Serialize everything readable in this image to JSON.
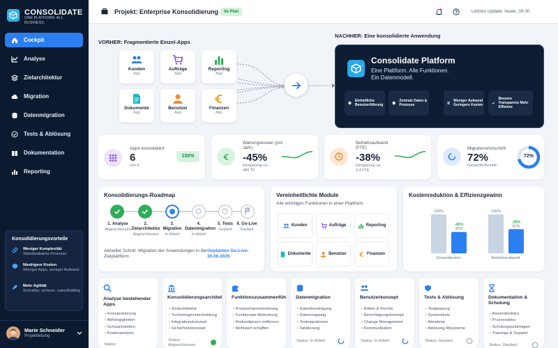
{
  "brand": {
    "name": "CONSOLIDATE",
    "tagline": "ONE PLATFORM. ALL BUSINESS."
  },
  "nav": [
    {
      "label": "Cockpit"
    },
    {
      "label": "Analyse"
    },
    {
      "label": "Zielarchitektur"
    },
    {
      "label": "Migration"
    },
    {
      "label": "Datenmigration"
    },
    {
      "label": "Tests & Ablösung"
    },
    {
      "label": "Dokumentation"
    },
    {
      "label": "Reporting"
    }
  ],
  "benefits": {
    "title": "Konsolidierungsvorteile",
    "items": [
      {
        "title": "Weniger Komplexität",
        "sub": "Standardisierte Prozesse"
      },
      {
        "title": "Niedrigere Kosten",
        "sub": "Weniger Apps, weniger Aufwand"
      },
      {
        "title": "Mehr Agilität",
        "sub": "Schneller, sicherer, zukunftsfähig"
      }
    ]
  },
  "user": {
    "name": "Marie Schneider",
    "role": "Projektleitung"
  },
  "topbar": {
    "project": "Projekt: Enterprise Konsolidierung",
    "badge": "Im Plan",
    "updated": "Letztes Update: heute, 09:30"
  },
  "before": {
    "title": "VORHER: Fragmentierte Einzel-Apps",
    "sub": "App",
    "apps": [
      {
        "name": "Kunden"
      },
      {
        "name": "Aufträge"
      },
      {
        "name": "Reporting"
      },
      {
        "name": "Dokumente"
      },
      {
        "name": "Benutzer"
      },
      {
        "name": "Finanzen"
      }
    ]
  },
  "after": {
    "title": "NACHHER: Eine konsolidierte Anwendung",
    "platform": "Consolidate Platform",
    "line1": "Eine Plattform. Alle Funktionen.",
    "line2": "Ein Datenmodell.",
    "features": [
      "Einheitliche Benutzerführung",
      "Zentrale Daten & Prozesse",
      "Weniger Aufwand Geringere Kosten",
      "Bessere Transparenz Mehr Effizienz"
    ]
  },
  "kpis": {
    "apps": {
      "label": "Apps konsolidiert",
      "value": "6",
      "sub": "von 6",
      "pct": "100%"
    },
    "maint": {
      "label": "Wartungskosten (pro Jahr)",
      "value": "-45%",
      "sub": "Einsparung ca. 480 T€"
    },
    "effort": {
      "label": "Betriebsaufwand (FTE)",
      "value": "-38%",
      "sub": "Einsparung ca. 2,4 FTE"
    },
    "migration": {
      "label": "Migrationsfortschritt",
      "value": "72%",
      "sub": "Gesamtfortschritt",
      "ring": "72%",
      "fraction": 0.72
    }
  },
  "roadmap": {
    "title": "Konsolidierungs-Roadmap",
    "steps": [
      {
        "label": "1. Analyse",
        "status": "Abgeschlossen"
      },
      {
        "label": "2. Zielarchitektur",
        "status": "Abgeschlossen"
      },
      {
        "label": "3. Migration",
        "status": "In Arbeit"
      },
      {
        "label": "4. Datenmigration",
        "status": "In Arbeit"
      },
      {
        "label": "5. Tests",
        "status": "Geplant"
      },
      {
        "label": "6. Go-Live",
        "status": "Geplant"
      }
    ],
    "current": "Aktueller Schritt: Migration der Anwendungen in die Zielplattform",
    "golive": "Geplantes Go-Live: 30.06.2025"
  },
  "modules": {
    "title": "Vereinheitlichte Module",
    "sub": "Alle wichtigen Funktionen in einer Plattform",
    "items": [
      "Kunden",
      "Aufträge",
      "Reporting",
      "Dokumente",
      "Benutzer",
      "Finanzen"
    ]
  },
  "costs": {
    "title": "Kostenreduktion & Effizienzgewinn"
  },
  "chart_data": {
    "type": "bar",
    "categories": [
      "Gesamtkosten",
      "Betriebsaufwand"
    ],
    "series": [
      {
        "values": [
          100,
          100
        ]
      },
      {
        "values": [
          55,
          62
        ]
      }
    ],
    "labels": [
      [
        "100%",
        "-45%",
        "55%"
      ],
      [
        "100%",
        "-38%",
        "62%"
      ]
    ],
    "ylim": [
      0,
      100
    ],
    "colors": [
      "#c9d4e3",
      "#2c7ff0"
    ]
  },
  "phases": [
    {
      "title": "Analyse bestehender Apps",
      "items": [
        "Inventarisierung",
        "Abhängigkeiten",
        "Schwachstellen",
        "Kostenanalyse"
      ],
      "status": "Status:"
    },
    {
      "title": "Konsolidierungsarchitektur",
      "items": [
        "Zielarchitektur",
        "Technologieentscheidung",
        "Integrationskonzept",
        "Sicherheitskonzept"
      ],
      "status": "Status: Abgeschlossen"
    },
    {
      "title": "Funktionszusammenführung",
      "items": [
        "Prozessharmonisierung",
        "Funktionale Abdeckung",
        "Redundanzen entfernen",
        "Mehrwert schaffen"
      ],
      "status": ""
    },
    {
      "title": "Datenmigration",
      "items": [
        "Datenbereinigung",
        "Datenmapping",
        "Testmigrationen",
        "Validierung"
      ],
      "status": "Status: In Arbeit"
    },
    {
      "title": "Benutzerkonzept",
      "items": [
        "Rollen & Rechte",
        "Berechtigungskonzept",
        "Change Management",
        "Kommunikation"
      ],
      "status": "Status: In Arbeit"
    },
    {
      "title": "Tests & Ablösung",
      "items": [
        "Testplanung",
        "Systemtests",
        "Abnahme",
        "Ablösung Altsysteme"
      ],
      "status": "Status: Geplant"
    },
    {
      "title": "Dokumentation & Schulung",
      "items": [
        "Anwenderdoku",
        "Prozessdoku",
        "Schulungsunterlagen",
        "Trainings & Support"
      ],
      "status": "Status: Geplant"
    }
  ]
}
